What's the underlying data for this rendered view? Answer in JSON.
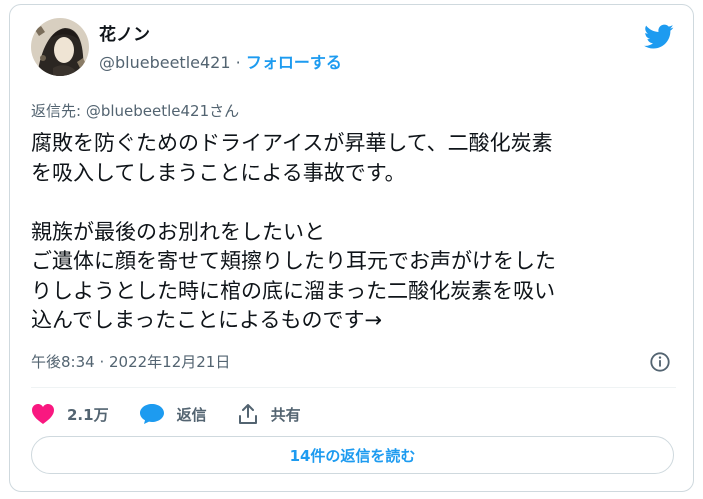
{
  "user": {
    "name": "花ノン",
    "handle": "@bluebeetle421",
    "separator": "·",
    "follow_label": "フォローする"
  },
  "tweet": {
    "reply_to": "返信先: @bluebeetle421さん",
    "text": "腐敗を防ぐためのドライアイスが昇華して、二酸化炭素\nを吸入してしまうことによる事故です。\n\n親族が最後のお別れをしたいと\nご遺体に顔を寄せて頬擦りしたり耳元でお声がけをした\nりしようとした時に棺の底に溜まった二酸化炭素を吸い\n込んでしまったことによるものです→",
    "timestamp": "午後8:34 · 2022年12月21日"
  },
  "actions": {
    "like_count": "2.1万",
    "reply_label": "返信",
    "share_label": "共有"
  },
  "read_replies_label": "14件の返信を読む",
  "icons": {
    "brand": "twitter-bird-icon",
    "info": "info-icon",
    "like": "heart-icon",
    "reply": "speech-bubble-icon",
    "share": "share-icon"
  },
  "colors": {
    "accent": "#1d9bf0",
    "like": "#f91880",
    "muted": "#536471",
    "text": "#0f1419",
    "border": "#cfd9de"
  }
}
